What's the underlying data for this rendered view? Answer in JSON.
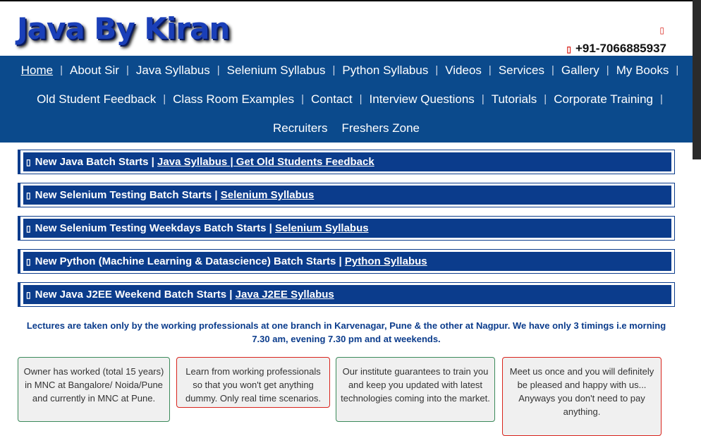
{
  "header": {
    "logo": "Java By Kiran",
    "phone": "+91-7066885937",
    "phone_icon": "phone-icon",
    "top_icon": "email-icon",
    "icon_glyph": "▯"
  },
  "nav": {
    "rows": [
      [
        "Home",
        "About Sir",
        "Java Syllabus",
        "Selenium Syllabus",
        "Python Syllabus",
        "Videos",
        "Services",
        "Gallery",
        "My Books"
      ],
      [
        "Old Student Feedback",
        "Class Room Examples",
        "Contact",
        "Interview Questions",
        "Tutorials",
        "Corporate Training"
      ],
      [
        "Recruiters",
        "Freshers Zone"
      ]
    ],
    "separator": "|"
  },
  "banners": [
    {
      "text": "New Java Batch Starts | ",
      "link": "Java Syllabus | Get Old Students Feedback"
    },
    {
      "text": "New Selenium Testing Batch Starts | ",
      "link": "Selenium Syllabus"
    },
    {
      "text": "New Selenium Testing Weekdays Batch Starts | ",
      "link": "Selenium Syllabus"
    },
    {
      "text": "New Python (Machine Learning & Datascience) Batch Starts | ",
      "link": "Python Syllabus"
    },
    {
      "text": "New Java J2EE Weekend Batch Starts | ",
      "link": "Java J2EE Syllabus"
    }
  ],
  "lectures": "Lectures are taken only by the working professionals at one branch in Karvenagar, Pune & the other at Nagpur. We have only 3 timings i.e morning 7.30 am, evening 7.30 pm and at weekends.",
  "cards": [
    {
      "text": "Owner has worked (total 15 years) in MNC at Bangalore/ Noida/Pune and currently in MNC at Pune.",
      "border": "green"
    },
    {
      "text": "Learn from working professionals so that you won't get anything dummy. Only real time scenarios.",
      "border": "red"
    },
    {
      "text": "Our institute guarantees to train you and keep you updated with latest technologies coming into the market.",
      "border": "green"
    },
    {
      "text": "Meet us once and you will definitely be pleased and happy with us...",
      "text2": "Anyways you don't need to pay anything.",
      "border": "red"
    }
  ],
  "colors": {
    "nav_bg": "#0b4a8c",
    "banner_bg": "#0b3c8c",
    "logo": "#1a3fb8",
    "accent_red": "#d9241c",
    "card_green_border": "#3b8a5a"
  }
}
